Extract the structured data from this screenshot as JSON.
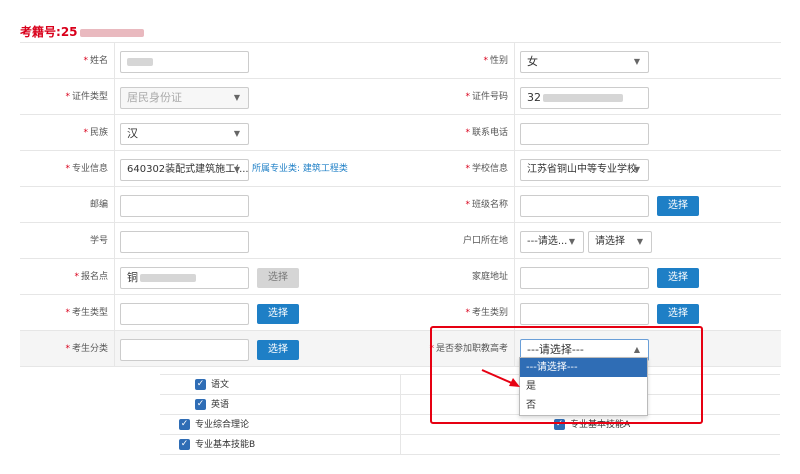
{
  "header": {
    "exam_no_label": "考籍号:",
    "exam_no_value": "25"
  },
  "fields": {
    "name": {
      "label": "姓名",
      "value": ""
    },
    "gender": {
      "label": "性别",
      "value": "女"
    },
    "id_type": {
      "label": "证件类型",
      "value": "居民身份证"
    },
    "id_no": {
      "label": "证件号码",
      "value": "32"
    },
    "ethnicity": {
      "label": "民族",
      "value": "汉"
    },
    "phone": {
      "label": "联系电话",
      "value": ""
    },
    "major": {
      "label": "专业信息",
      "value": "640302装配式建筑施工(...",
      "category_link": "所属专业类: 建筑工程类"
    },
    "school": {
      "label": "学校信息",
      "value": "江苏省铜山中等专业学校"
    },
    "postcode": {
      "label": "邮编",
      "value": ""
    },
    "class_name": {
      "label": "班级名称",
      "value": "",
      "button": "选择"
    },
    "student_no": {
      "label": "学号",
      "value": ""
    },
    "hukou": {
      "label": "户口所在地",
      "value1": "---请选...",
      "value2": "请选择"
    },
    "exam_site": {
      "label": "报名点",
      "value": "铜",
      "button": "选择"
    },
    "home_address": {
      "label": "家庭地址",
      "value": "",
      "button": "选择"
    },
    "exam_type": {
      "label": "考生类型",
      "value": "",
      "button": "选择"
    },
    "exam_category": {
      "label": "考生类别",
      "value": "",
      "button": "选择"
    },
    "exam_class": {
      "label": "考生分类",
      "value": "",
      "button": "选择"
    },
    "vocational_exam": {
      "label": "是否参加职教高考",
      "value": "---请选择---",
      "options": [
        "---请选择---",
        "是",
        "否"
      ]
    }
  },
  "subjects": {
    "left": [
      "语文",
      "英语",
      "专业综合理论",
      "专业基本技能B"
    ],
    "right_visible": "专业基本技能A"
  },
  "colors": {
    "required": "#d9001b",
    "button": "#1e7fc6",
    "highlight": "#e60012",
    "selected_option": "#2f6db5"
  }
}
